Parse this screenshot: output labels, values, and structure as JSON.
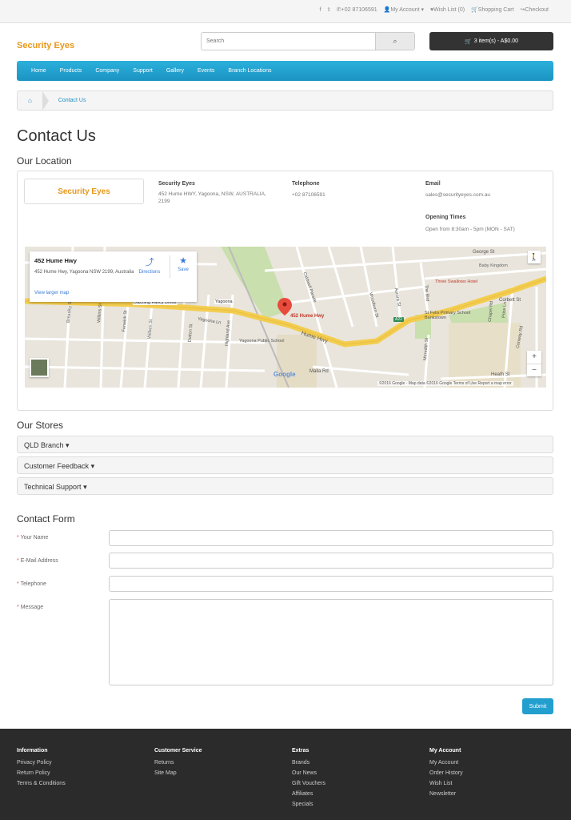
{
  "topbar": {
    "phone": "+02 87106591",
    "my_account": "My Account",
    "wishlist": "Wish List (0)",
    "cart": "Shopping Cart",
    "checkout": "Checkout"
  },
  "header": {
    "logo": "Security Eyes",
    "search_placeholder": "Search",
    "cart_summary": "3 item(s) - A$0.00"
  },
  "nav": [
    "Home",
    "Products",
    "Company",
    "Support",
    "Gallery",
    "Events",
    "Branch Locations"
  ],
  "breadcrumb": {
    "current": "Contact Us"
  },
  "page": {
    "title": "Contact Us",
    "location_heading": "Our Location"
  },
  "store": {
    "logo": "Security Eyes",
    "name_label": "Security Eyes",
    "address": "452 Hume HWY, Yagoona, NSW, AUSTRALIA, 2199",
    "telephone_label": "Telephone",
    "telephone": "+02 87106591",
    "email_label": "Email",
    "email": "sales@securityeyes.com.au",
    "opening_label": "Opening Times",
    "opening": "Open from 8:30am - 5pm (MON - SAT)"
  },
  "map": {
    "card_title": "452 Hume Hwy",
    "card_address": "452 Hume Hwy, Yagoona NSW 2199, Australia",
    "directions": "Directions",
    "save": "Save",
    "larger_map": "View larger map",
    "marker_label": "452 Hume Hwy",
    "road_hume": "Hume Hwy",
    "attribution": "©2016 Google · Map data ©2016 Google    Terms of Use    Report a map error",
    "google": "Google",
    "labels": {
      "george_st": "George St",
      "baby_kingdom": "Baby Kingdom",
      "three_swallows": "Three Swallows Hotel",
      "corbett_st": "Corbett St",
      "st_felix": "St Felix Primary School Bankstown",
      "dazzling": "Dazzling Fancy Dress",
      "yagoona": "Yagoona",
      "yagoona_ln": "Yagoona Ln",
      "yagoona_school": "Yagoona Public School",
      "malla_rd": "Malla Rd",
      "heath_st": "Heath St",
      "caldwell": "Caldwell Parade",
      "woodburn": "Woodburn St",
      "auora": "Aurora St",
      "the_bird": "The Bird",
      "highland": "Highland Ave",
      "dutton": "Dutton St",
      "william": "William St",
      "fenwick": "Fenwick St",
      "wilkins": "Wilkins St",
      "breasley": "Breasley St",
      "chapel_rd": "Chapel Rd",
      "price_ln": "Price Ln",
      "conway_rd": "Conway Rd",
      "meredith": "Meredith St",
      "hume_shield": "A22"
    }
  },
  "stores": {
    "heading": "Our Stores",
    "items": [
      "QLD Branch",
      "Customer Feedback",
      "Technical Support"
    ]
  },
  "form": {
    "heading": "Contact Form",
    "required_mark": "*",
    "name": "Your Name",
    "email": "E-Mail Address",
    "telephone": "Telephone",
    "message": "Message",
    "submit": "Submit"
  },
  "footer": {
    "cols": [
      {
        "title": "Information",
        "links": [
          "Privacy Policy",
          "Return Policy",
          "Terms & Conditions"
        ]
      },
      {
        "title": "Customer Service",
        "links": [
          "Returns",
          "Site Map"
        ]
      },
      {
        "title": "Extras",
        "links": [
          "Brands",
          "Our News",
          "Gift Vouchers",
          "Affiliates",
          "Specials"
        ]
      },
      {
        "title": "My Account",
        "links": [
          "My Account",
          "Order History",
          "Wish List",
          "Newsletter"
        ]
      }
    ]
  },
  "colors": {
    "accent": "#229fcf",
    "logo": "#e8981c",
    "footer": "#2b2b2b"
  }
}
